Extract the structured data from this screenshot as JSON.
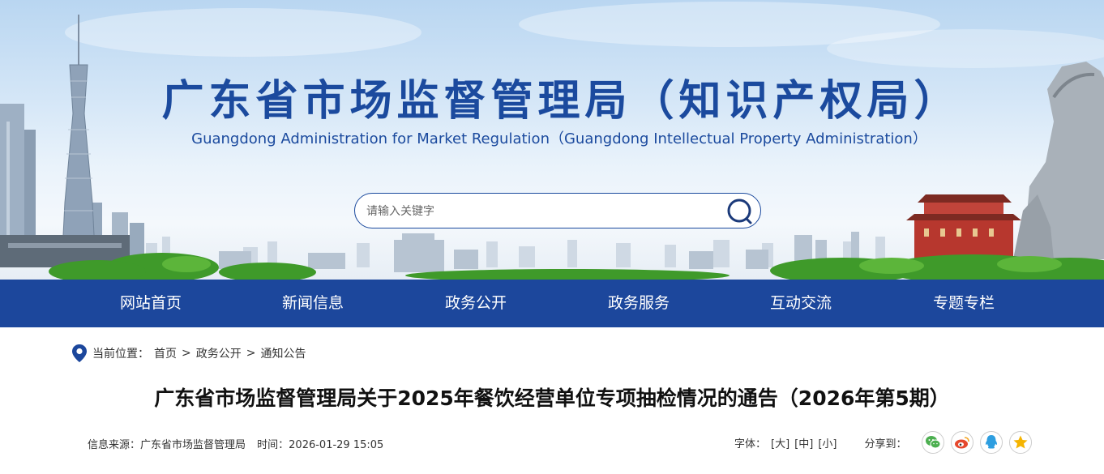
{
  "header": {
    "title": "广东省市场监督管理局（知识产权局）",
    "subtitle": "Guangdong Administration for Market Regulation（Guangdong Intellectual Property Administration）"
  },
  "search": {
    "placeholder": "请输入关键字",
    "value": ""
  },
  "nav": {
    "items": [
      {
        "label": "网站首页"
      },
      {
        "label": "新闻信息"
      },
      {
        "label": "政务公开"
      },
      {
        "label": "政务服务"
      },
      {
        "label": "互动交流"
      },
      {
        "label": "专题专栏"
      }
    ]
  },
  "breadcrumb": {
    "label": "当前位置：",
    "items": [
      "首页",
      "政务公开",
      "通知公告"
    ],
    "separator": ">"
  },
  "article": {
    "title": "广东省市场监督管理局关于2025年餐饮经营单位专项抽检情况的通告（2026年第5期）",
    "source": "信息来源：广东省市场监督管理局",
    "time": "时间：2026-01-29 15:05"
  },
  "tools": {
    "font_label": "字体：",
    "font_large": "[大]",
    "font_medium": "[中]",
    "font_small": "[小]",
    "share_label": "分享到："
  },
  "share": {
    "icons": [
      "wechat-icon",
      "weibo-icon",
      "qq-icon",
      "qzone-icon"
    ]
  },
  "colors": {
    "brand_blue": "#1c479c",
    "title_blue": "#1b4a9e",
    "wechat_green": "#4caf50",
    "weibo_red": "#e6492d",
    "qq_blue": "#2d9ee0",
    "qzone_yellow": "#f5b400"
  }
}
